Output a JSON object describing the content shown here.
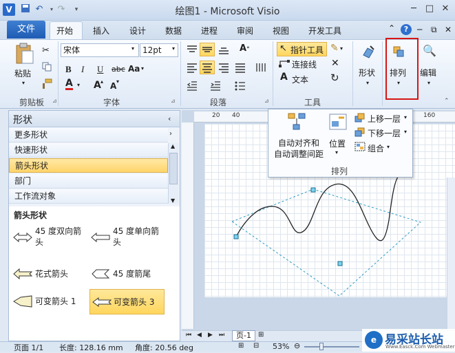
{
  "app": {
    "title": "绘图1 - Microsoft Visio",
    "logo": "V"
  },
  "qat": {
    "save_icon": "save-icon",
    "undo_icon": "undo-icon",
    "redo_icon": "redo-icon"
  },
  "window": {
    "minimize": "─",
    "restore": "□",
    "close": "✕"
  },
  "tabs": [
    "文件",
    "开始",
    "插入",
    "设计",
    "数据",
    "进程",
    "审阅",
    "视图",
    "开发工具"
  ],
  "tab_icons": {
    "minimize_ribbon": "⌃",
    "help": "?",
    "wmin": "─",
    "wrestore": "⧉",
    "wclose": "✕"
  },
  "clipboard": {
    "paste": "粘贴",
    "group": "剪贴板"
  },
  "font": {
    "name": "宋体",
    "size": "12pt",
    "group": "字体",
    "bold": "B",
    "italic": "I",
    "underline": "U",
    "strike": "abc",
    "case": "Aa",
    "color": "A",
    "grow": "A",
    "shrink": "A"
  },
  "paragraph": {
    "group": "段落"
  },
  "tools": {
    "pointer": "指针工具",
    "connector": "连接线",
    "text": "文本",
    "group": "工具"
  },
  "shape_btn": {
    "label": "形状"
  },
  "arrange_btn": {
    "label": "排列"
  },
  "edit_btn": {
    "label": "编辑"
  },
  "dropdown": {
    "auto_align_line1": "自动对齐和",
    "auto_align_line2": "自动调整间距",
    "position": "位置",
    "bring_forward": "上移一层",
    "send_backward": "下移一层",
    "group": "组合",
    "section": "排列"
  },
  "panel": {
    "title": "形状",
    "items": [
      "更多形状",
      "快速形状",
      "箭头形状",
      "部门",
      "工作流对象"
    ],
    "stencil_title": "箭头形状",
    "shapes": [
      {
        "label_line1": "45 度双向箭",
        "label_line2": "头"
      },
      {
        "label_line1": "45 度单向箭",
        "label_line2": "头"
      },
      {
        "label_line1": "花式箭头",
        "label_line2": ""
      },
      {
        "label_line1": "45 度箭尾",
        "label_line2": ""
      },
      {
        "label_line1": "可变箭头 1",
        "label_line2": ""
      },
      {
        "label_line1": "可变箭头 3",
        "label_line2": ""
      }
    ]
  },
  "ruler": {
    "h": [
      "20",
      "40",
      "160"
    ]
  },
  "page_tab": "页-1",
  "status": {
    "page": "页面 1/1",
    "length": "长度: 128.16 mm",
    "angle": "角度: 20.56 deg",
    "zoom": "53%"
  },
  "watermark": {
    "brand": "易采站长站",
    "url": "Www.Easck.Com Webmaster"
  }
}
